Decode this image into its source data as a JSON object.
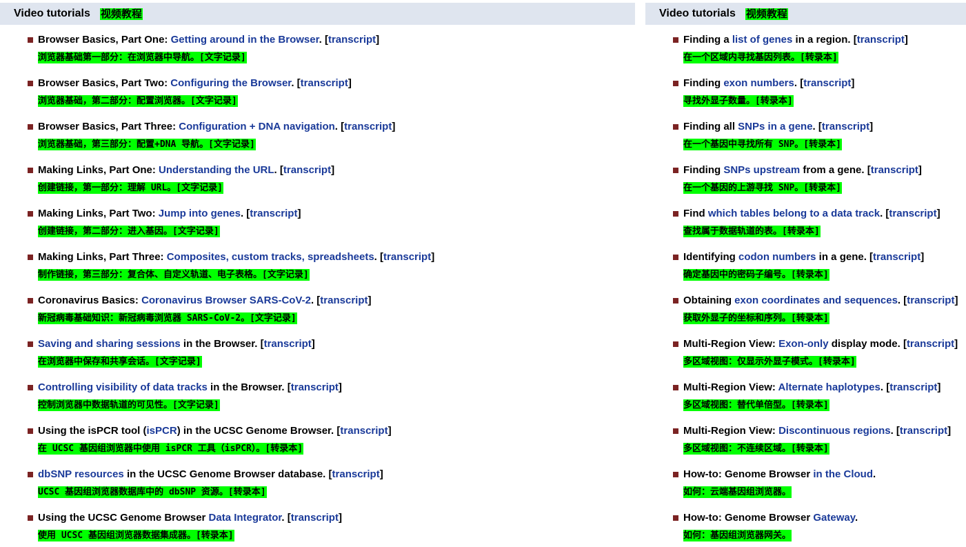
{
  "left_panel": {
    "title": "Video tutorials",
    "title_zh": "视频教程",
    "items": [
      {
        "pre": "Browser Basics, Part One: ",
        "link": "Getting around in the Browser",
        "mid": ". [",
        "link2": "transcript",
        "post": "]",
        "zh": "浏览器基础第一部分：在浏览器中导航。[文字记录]"
      },
      {
        "pre": "Browser Basics, Part Two: ",
        "link": "Configuring the Browser",
        "mid": ". [",
        "link2": "transcript",
        "post": "]",
        "zh": "浏览器基础，第二部分：配置浏览器。[文字记录]"
      },
      {
        "pre": "Browser Basics, Part Three: ",
        "link": "Configuration + DNA navigation",
        "mid": ". [",
        "link2": "transcript",
        "post": "]",
        "zh": "浏览器基础，第三部分：配置+DNA 导航。[文字记录]"
      },
      {
        "pre": "Making Links, Part One: ",
        "link": "Understanding the URL",
        "mid": ". [",
        "link2": "transcript",
        "post": "]",
        "zh": "创建链接，第一部分：理解 URL。[文字记录]"
      },
      {
        "pre": "Making Links, Part Two: ",
        "link": "Jump into genes",
        "mid": ". [",
        "link2": "transcript",
        "post": "]",
        "zh": "创建链接，第二部分：进入基因。[文字记录]"
      },
      {
        "pre": "Making Links, Part Three: ",
        "link": "Composites, custom tracks, spreadsheets",
        "mid": ". [",
        "link2": "transcript",
        "post": "]",
        "zh": "制作链接，第三部分：复合体、自定义轨道、电子表格。[文字记录]"
      },
      {
        "pre": "Coronavirus Basics: ",
        "link": "Coronavirus Browser SARS-CoV-2",
        "mid": ". [",
        "link2": "transcript",
        "post": "]",
        "zh": "新冠病毒基础知识：新冠病毒浏览器 SARS-CoV-2。[文字记录]"
      },
      {
        "pre": "",
        "link": "Saving and sharing sessions",
        "mid": " in the Browser. [",
        "link2": "transcript",
        "post": "]",
        "zh": "在浏览器中保存和共享会话。[文字记录]"
      },
      {
        "pre": "",
        "link": "Controlling visibility of data tracks",
        "mid": " in the Browser. [",
        "link2": "transcript",
        "post": "]",
        "zh": "控制浏览器中数据轨道的可见性。[文字记录]"
      },
      {
        "pre": "Using the isPCR tool (",
        "link": "isPCR",
        "mid": ") in the UCSC Genome Browser. [",
        "link2": "transcript",
        "post": "]",
        "zh": "在 UCSC 基因组浏览器中使用 isPCR 工具（isPCR）。[转录本]"
      },
      {
        "pre": "",
        "link": "dbSNP resources",
        "mid": " in the UCSC Genome Browser database. [",
        "link2": "transcript",
        "post": "]",
        "zh": "UCSC 基因组浏览器数据库中的 dbSNP 资源。[转录本]"
      },
      {
        "pre": "Using the UCSC Genome Browser ",
        "link": "Data Integrator",
        "mid": ". [",
        "link2": "transcript",
        "post": "]",
        "zh": "使用 UCSC 基因组浏览器数据集成器。[转录本]"
      }
    ]
  },
  "right_panel": {
    "title": "Video tutorials",
    "title_zh": "视频教程",
    "items": [
      {
        "pre": "Finding a ",
        "link": "list of genes",
        "mid": " in a region. [",
        "link2": "transcript",
        "post": "]",
        "zh": "在一个区域内寻找基因列表。[转录本]"
      },
      {
        "pre": "Finding ",
        "link": "exon numbers",
        "mid": ". [",
        "link2": "transcript",
        "post": "]",
        "zh": "寻找外显子数量。[转录本]"
      },
      {
        "pre": "Finding all ",
        "link": "SNPs in a gene",
        "mid": ". [",
        "link2": "transcript",
        "post": "]",
        "zh": "在一个基因中寻找所有 SNP。[转录本]"
      },
      {
        "pre": "Finding ",
        "link": "SNPs upstream",
        "mid": " from a gene. [",
        "link2": "transcript",
        "post": "]",
        "zh": "在一个基因的上游寻找 SNP。[转录本]"
      },
      {
        "pre": "Find ",
        "link": "which tables belong to a data track",
        "mid": ". [",
        "link2": "transcript",
        "post": "]",
        "zh": "查找属于数据轨道的表。[转录本]"
      },
      {
        "pre": "Identifying ",
        "link": "codon numbers",
        "mid": " in a gene. [",
        "link2": "transcript",
        "post": "]",
        "zh": "确定基因中的密码子编号。[转录本]"
      },
      {
        "pre": "Obtaining ",
        "link": "exon coordinates and sequences",
        "mid": ". [",
        "link2": "transcript",
        "post": "]",
        "zh": "获取外显子的坐标和序列。[转录本]"
      },
      {
        "pre": "Multi-Region View: ",
        "link": "Exon-only",
        "mid": " display mode. [",
        "link2": "transcript",
        "post": "]",
        "zh": "多区域视图：仅显示外显子模式。[转录本]"
      },
      {
        "pre": "Multi-Region View: ",
        "link": "Alternate haplotypes",
        "mid": ". [",
        "link2": "transcript",
        "post": "]",
        "zh": "多区域视图：替代单倍型。[转录本]"
      },
      {
        "pre": "Multi-Region View: ",
        "link": "Discontinuous regions",
        "mid": ". [",
        "link2": "transcript",
        "post": "]",
        "zh": "多区域视图：不连续区域。[转录本]"
      },
      {
        "pre": "How-to: Genome Browser ",
        "link": "in the Cloud",
        "mid": ".",
        "link2": "",
        "post": "",
        "zh": "如何：云端基因组浏览器。"
      },
      {
        "pre": "How-to: Genome Browser ",
        "link": "Gateway",
        "mid": ".",
        "link2": "",
        "post": "",
        "zh": "如何：基因组浏览器网关。"
      }
    ]
  },
  "colors": {
    "header_bg": "#dfe5ef",
    "highlight": "#00ff00",
    "link": "#1a3a99",
    "bullet": "#7b2323"
  }
}
